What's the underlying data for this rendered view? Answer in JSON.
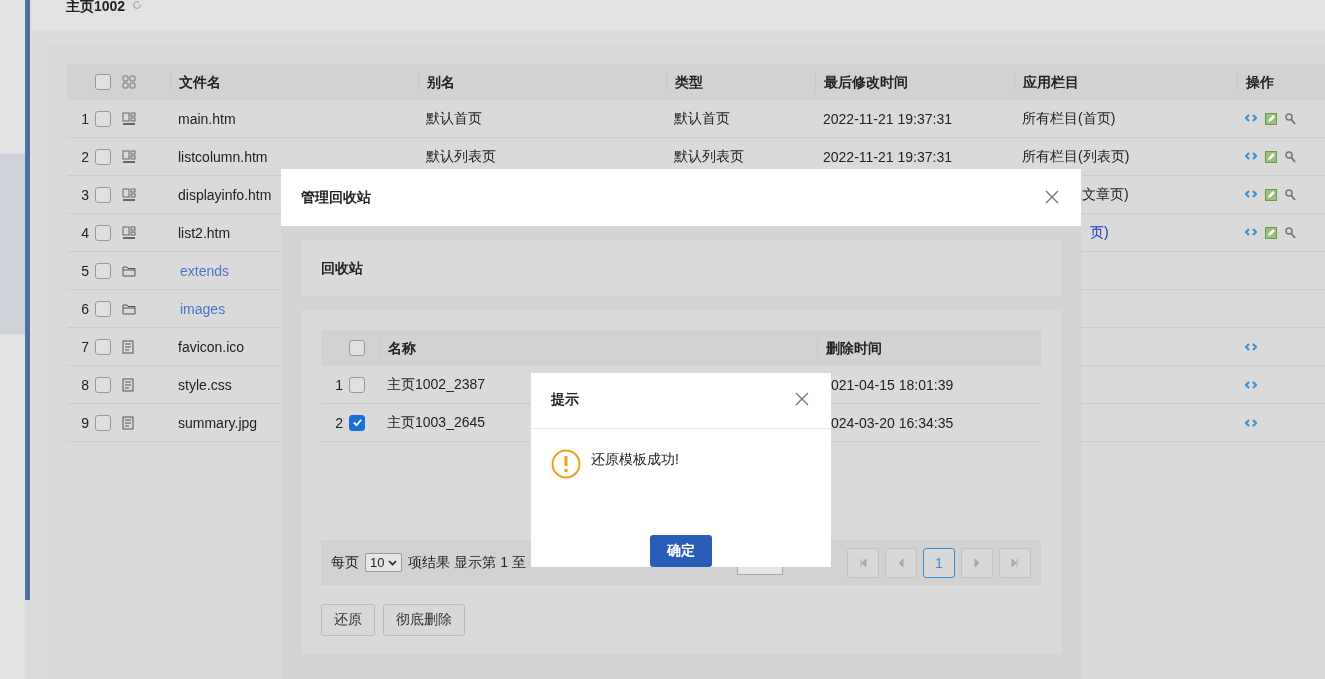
{
  "page_title": "主页1002",
  "table": {
    "columns": [
      "文件名",
      "别名",
      "类型",
      "最后修改时间",
      "应用栏目",
      "操作"
    ],
    "all_checked": false,
    "rows": [
      {
        "index": "1",
        "checked": false,
        "kind": "template",
        "name": "main.htm",
        "alias": "默认首页",
        "type": "默认首页",
        "modified": "2022-11-21 19:37:31",
        "app_column": "所有栏目(首页)",
        "actions": [
          {
            "kind": "code"
          },
          {
            "kind": "edit"
          },
          {
            "kind": "search"
          }
        ]
      },
      {
        "index": "2",
        "checked": false,
        "kind": "template",
        "name": "listcolumn.htm",
        "alias": "默认列表页",
        "type": "默认列表页",
        "modified": "2022-11-21 19:37:31",
        "app_column": "所有栏目(列表页)",
        "actions": [
          {
            "kind": "code"
          },
          {
            "kind": "edit"
          },
          {
            "kind": "search"
          }
        ]
      },
      {
        "index": "3",
        "checked": false,
        "kind": "template",
        "name": "displayinfo.htm",
        "app_column": "文章页)",
        "actions": [
          {
            "kind": "code"
          },
          {
            "kind": "edit"
          },
          {
            "kind": "search"
          }
        ]
      },
      {
        "index": "4",
        "checked": false,
        "kind": "template",
        "name": "list2.htm",
        "app_column": "页)",
        "actions": [
          {
            "kind": "code"
          },
          {
            "kind": "edit"
          },
          {
            "kind": "search"
          }
        ]
      },
      {
        "index": "5",
        "checked": false,
        "kind": "folder",
        "name": "extends",
        "actions": []
      },
      {
        "index": "6",
        "checked": false,
        "kind": "folder",
        "name": "images",
        "actions": []
      },
      {
        "index": "7",
        "checked": false,
        "kind": "file",
        "name": "favicon.ico",
        "actions": [
          {
            "kind": "code"
          }
        ]
      },
      {
        "index": "8",
        "checked": false,
        "kind": "file",
        "name": "style.css",
        "actions": [
          {
            "kind": "code"
          }
        ]
      },
      {
        "index": "9",
        "checked": false,
        "kind": "file",
        "name": "summary.jpg",
        "actions": [
          {
            "kind": "code"
          }
        ]
      }
    ]
  },
  "recycle_dialog": {
    "title": "管理回收站",
    "section_title": "回收站",
    "columns": [
      "名称",
      "删除时间"
    ],
    "all_checked": false,
    "rows": [
      {
        "index": "1",
        "checked": false,
        "name": "主页1002_2387",
        "deleted": "021-04-15 18:01:39"
      },
      {
        "index": "2",
        "checked": true,
        "name": "主页1003_2645",
        "deleted": "024-03-20 16:34:35"
      }
    ],
    "pager": {
      "per_page_label": "每页",
      "page_size": "10",
      "summary": "项结果 显示第 1 至",
      "pages": [
        {
          "label": "1",
          "selected": true
        }
      ]
    },
    "buttons": [
      "还原",
      "彻底删除"
    ]
  },
  "alert": {
    "title": "提示",
    "message": "还原模板成功!",
    "button": "确定"
  }
}
